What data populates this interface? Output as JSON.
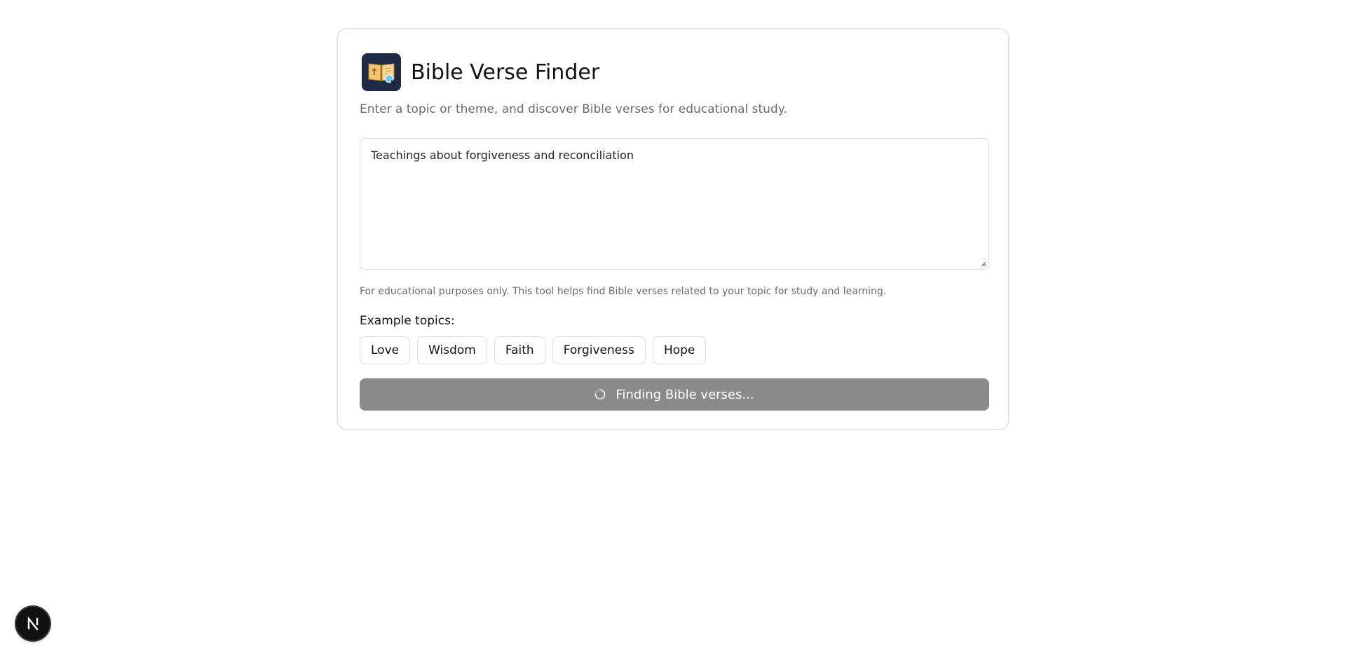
{
  "app": {
    "title": "Bible Verse Finder",
    "subtitle": "Enter a topic or theme, and discover Bible verses for educational study.",
    "logo_icon": "open-book-magnifier-icon"
  },
  "input": {
    "value": "Teachings about forgiveness and reconciliation"
  },
  "disclaimer": "For educational purposes only. This tool helps find Bible verses related to your topic for study and learning.",
  "examples": {
    "label": "Example topics:",
    "topics": [
      "Love",
      "Wisdom",
      "Faith",
      "Forgiveness",
      "Hope"
    ]
  },
  "submit": {
    "label": "Finding Bible verses...",
    "state": "loading",
    "icon": "spinner-icon"
  },
  "dev_badge": {
    "label": "N",
    "icon": "nextjs-icon"
  },
  "colors": {
    "button_loading": "#8a8a8a",
    "logo_bg": "#1f2a44",
    "border": "#dcdcdc",
    "muted_text": "#6b6b6b"
  }
}
